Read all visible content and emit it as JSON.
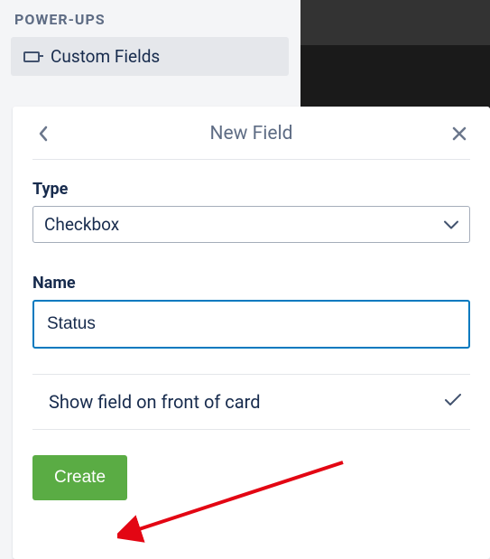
{
  "sidebar": {
    "section_title": "POWER-UPS",
    "custom_fields_label": "Custom Fields"
  },
  "modal": {
    "title": "New Field",
    "type_label": "Type",
    "type_value": "Checkbox",
    "name_label": "Name",
    "name_value": "Status",
    "show_on_front_label": "Show field on front of card",
    "create_label": "Create"
  }
}
